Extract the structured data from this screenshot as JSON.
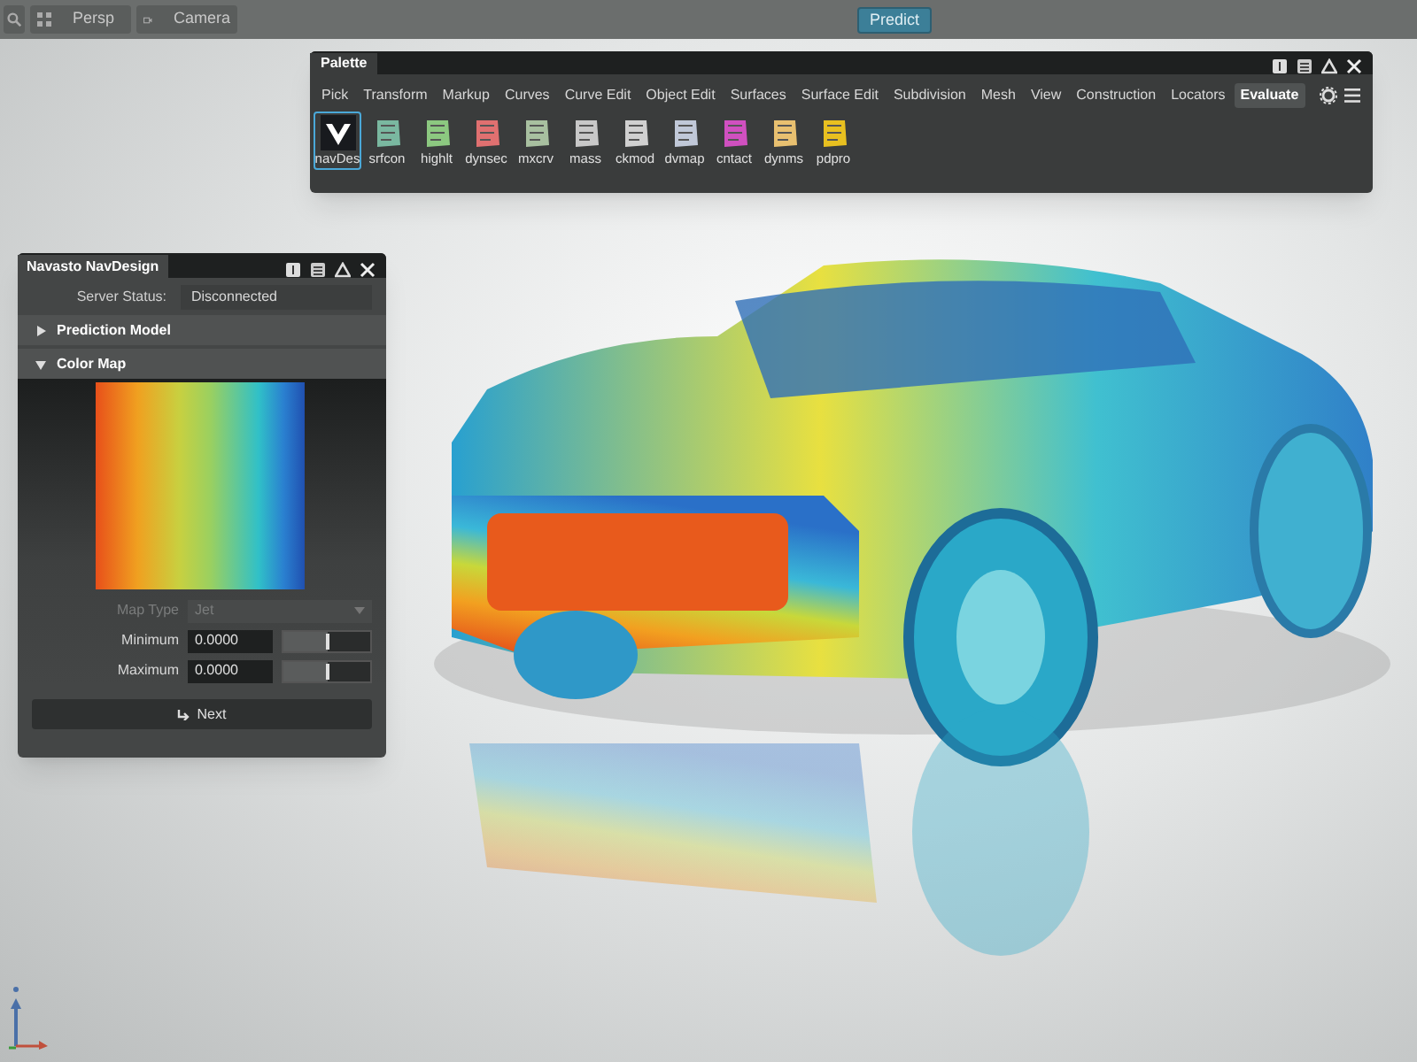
{
  "toolbar": {
    "views": [
      {
        "kind": "grid",
        "label": "Persp"
      },
      {
        "kind": "camera",
        "label": "Camera"
      }
    ],
    "predict_button": "Predict"
  },
  "palette": {
    "title": "Palette",
    "tabs": [
      {
        "label": "Pick",
        "selected": false
      },
      {
        "label": "Transform",
        "selected": false
      },
      {
        "label": "Markup",
        "selected": false
      },
      {
        "label": "Curves",
        "selected": false
      },
      {
        "label": "Curve Edit",
        "selected": false
      },
      {
        "label": "Object Edit",
        "selected": false
      },
      {
        "label": "Surfaces",
        "selected": false
      },
      {
        "label": "Surface Edit",
        "selected": false
      },
      {
        "label": "Subdivision",
        "selected": false
      },
      {
        "label": "Mesh",
        "selected": false
      },
      {
        "label": "View",
        "selected": false
      },
      {
        "label": "Construction",
        "selected": false
      },
      {
        "label": "Locators",
        "selected": false
      },
      {
        "label": "Evaluate",
        "selected": true
      }
    ],
    "tools": [
      {
        "label": "navDes",
        "selected": true
      },
      {
        "label": "srfcon",
        "selected": false
      },
      {
        "label": "highlt",
        "selected": false
      },
      {
        "label": "dynsec",
        "selected": false
      },
      {
        "label": "mxcrv",
        "selected": false
      },
      {
        "label": "mass",
        "selected": false
      },
      {
        "label": "ckmod",
        "selected": false
      },
      {
        "label": "dvmap",
        "selected": false
      },
      {
        "label": "cntact",
        "selected": false
      },
      {
        "label": "dynms",
        "selected": false
      },
      {
        "label": "pdpro",
        "selected": false
      }
    ]
  },
  "navdesign": {
    "title": "Navasto NavDesign",
    "server_status_label": "Server Status:",
    "server_status": "Disconnected",
    "sections": [
      {
        "label": "Prediction Model",
        "expanded": false
      },
      {
        "label": "Color Map",
        "expanded": true
      }
    ],
    "map_type": {
      "label": "Map Type",
      "value": "Jet",
      "disabled": true
    },
    "ranges": [
      {
        "label": "Minimum",
        "value": "0.0000",
        "level": 0.5
      },
      {
        "label": "Maximum",
        "value": "0.0000",
        "level": 0.5
      }
    ],
    "next_button": "Next"
  }
}
